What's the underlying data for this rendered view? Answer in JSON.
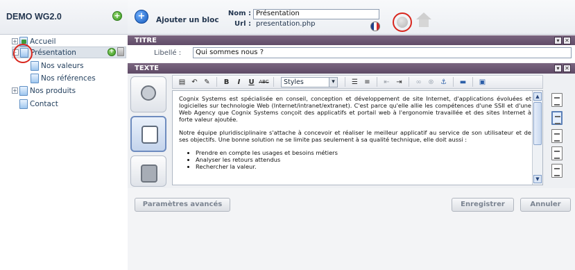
{
  "site": {
    "title": "DEMO WG2.0",
    "add_symbol": "+"
  },
  "tree": {
    "items": [
      {
        "label": "Accueil",
        "expander": "+"
      },
      {
        "label": "Présentation",
        "expander": "-"
      },
      {
        "label": "Nos valeurs"
      },
      {
        "label": "Nos références"
      },
      {
        "label": "Nos produits",
        "expander": "+"
      },
      {
        "label": "Contact"
      }
    ]
  },
  "topbar": {
    "add_block_label": "Ajouter un bloc",
    "add_block_symbol": "+",
    "nom_label": "Nom :",
    "nom_value": "Présentation",
    "url_label": "Url :",
    "url_value": "presentation.php"
  },
  "sections": {
    "titre": {
      "header": "TITRE",
      "libelle_label": "Libellé :",
      "libelle_value": "Qui sommes nous ?"
    },
    "texte": {
      "header": "TEXTE"
    }
  },
  "header_buttons": {
    "collapse": "▾",
    "close": "✕"
  },
  "editor": {
    "styles_value": "Styles",
    "toolbar_glyphs": {
      "bold": "B",
      "italic": "I",
      "underline": "U",
      "strike": "ABC"
    },
    "content": {
      "paragraph1": "Cognix Systems est spécialisée en conseil, conception et développement de site Internet, d'applications évoluées et logicielles sur technologie Web (Internet/intranet/extranet). C'est parce qu'elle allie les compétences d'une SSII et d'une Web Agency que Cognix Systems conçoit des applicatifs et portail web à l'ergonomie travaillée et des sites Internet à forte valeur ajoutée.",
      "paragraph2": "Notre équipe pluridisciplinaire s'attache à concevoir et réaliser le meilleur applicatif au service de son utilisateur et de ses objectifs. Une bonne solution ne se limite pas seulement à sa qualité technique, elle doit aussi :",
      "bullets": [
        "Prendre en compte les usages et besoins métiers",
        "Analyser les retours attendus",
        "Rechercher la valeur."
      ]
    }
  },
  "buttons": {
    "advanced": "Paramètres avancés",
    "save": "Enregistrer",
    "cancel": "Annuler"
  },
  "colors": {
    "section_header": "#6a5571",
    "highlight_circle": "#d8261d",
    "accent_blue": "#1558b8"
  }
}
